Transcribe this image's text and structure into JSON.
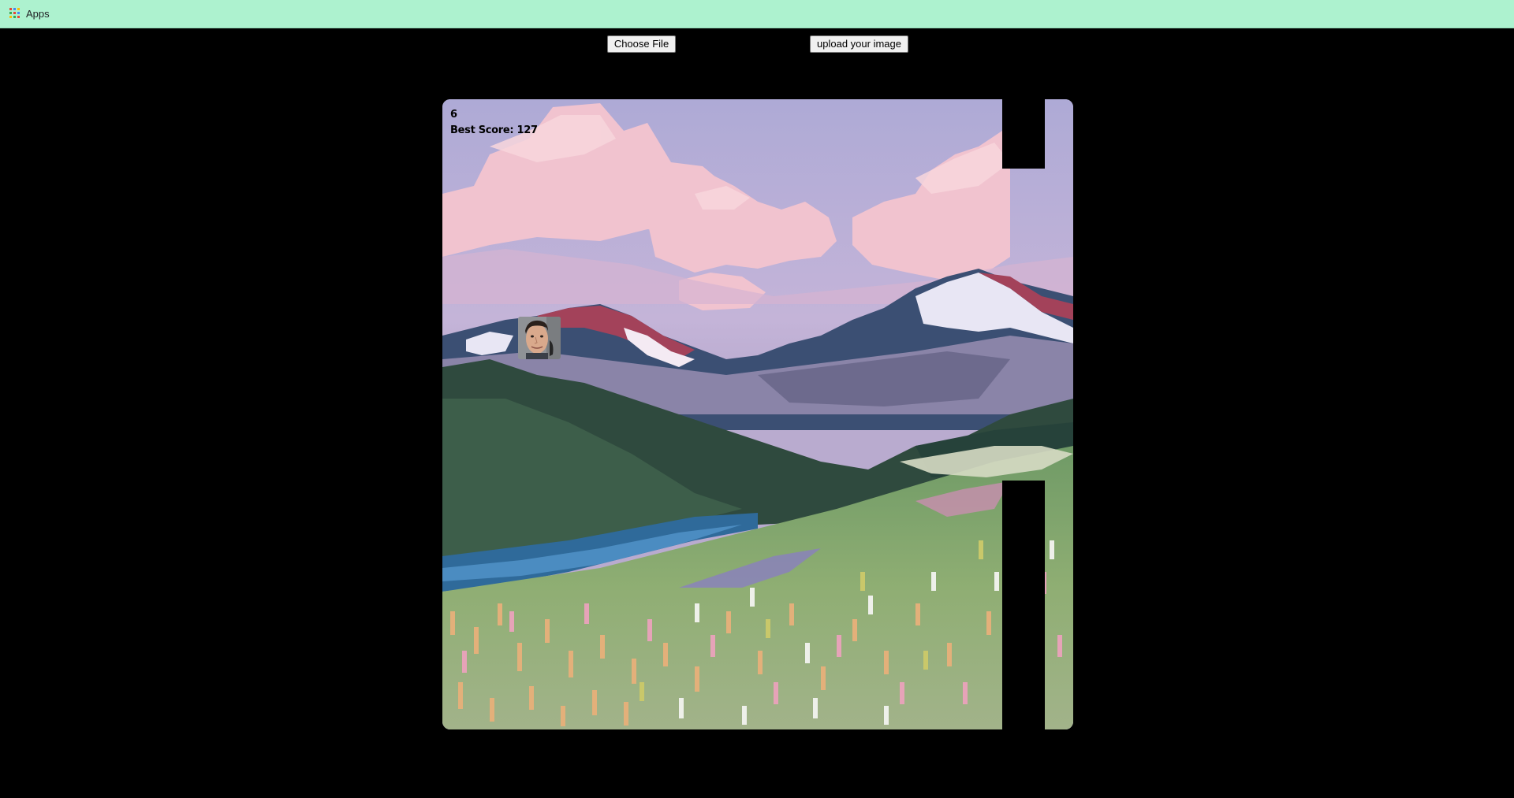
{
  "bookmarks_bar": {
    "apps_label": "Apps",
    "apps_icon": "apps-grid-icon",
    "background": "#adf2cf"
  },
  "controls": {
    "choose_file_label": "Choose File",
    "upload_label": "upload your image"
  },
  "game": {
    "score": "6",
    "best_score_text": "Best Score: 127",
    "player_icon": "face-avatar-icon",
    "pipe_color": "#000000",
    "scene": "pixel-art-mountain-meadow"
  }
}
